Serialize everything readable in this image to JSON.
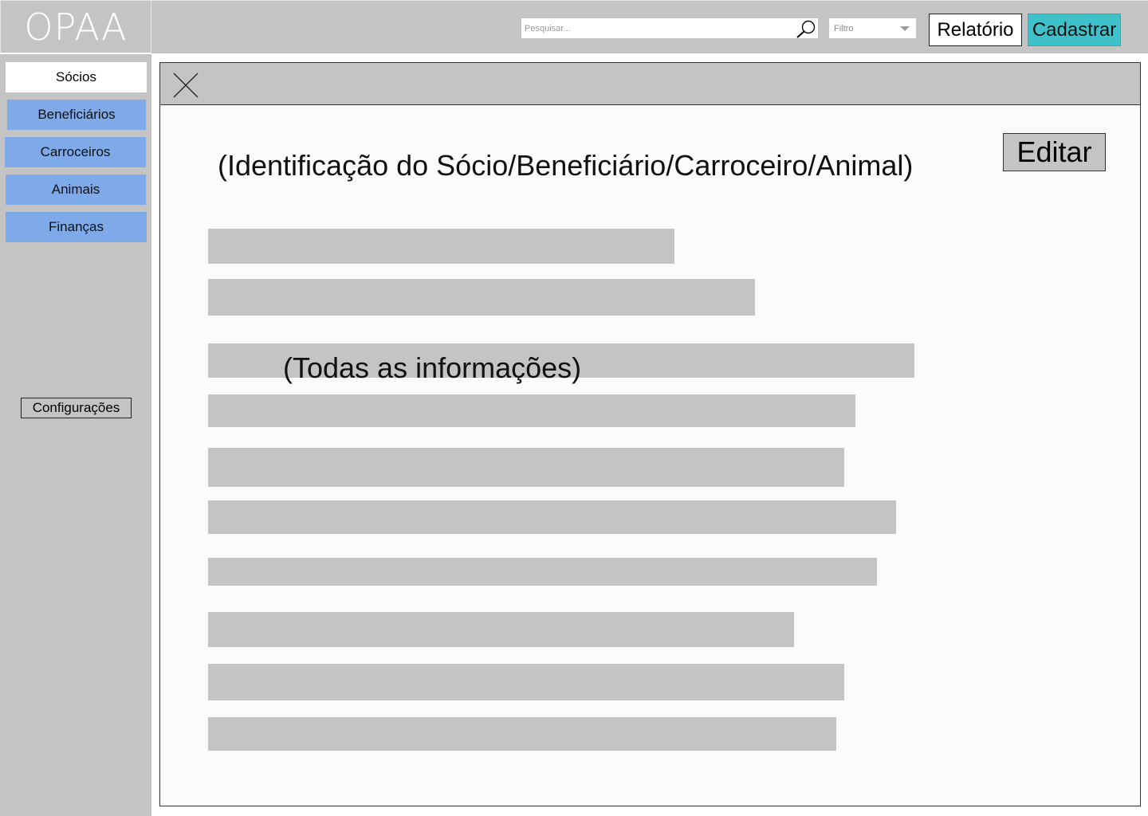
{
  "sidebar": {
    "logo": "OPAA",
    "items": [
      {
        "label": "Sócios",
        "active": true
      },
      {
        "label": "Beneficiários",
        "active": false
      },
      {
        "label": "Carroceiros",
        "active": false
      },
      {
        "label": "Animais",
        "active": false
      },
      {
        "label": "Finanças",
        "active": false
      }
    ],
    "settings_label": "Configurações"
  },
  "topbar": {
    "search": {
      "placeholder": "Pesquisar...",
      "value": ""
    },
    "filter": {
      "selected": "Filtro"
    },
    "report_label": "Relatório",
    "register_label": "Cadastrar"
  },
  "detail": {
    "title": "(Identificação do Sócio/Beneficiário/Carroceiro/Animal)",
    "edit_label": "Editar",
    "info_caption": "(Todas as informações)"
  },
  "colors": {
    "gray": "#c4c4c4",
    "nav_blue": "#7eaaea",
    "accent_teal": "#3fc1c9",
    "panel_bg": "#fcfbf9"
  },
  "icons": {
    "search": "search-icon",
    "close": "close-icon",
    "dropdown": "chevron-down-icon"
  }
}
